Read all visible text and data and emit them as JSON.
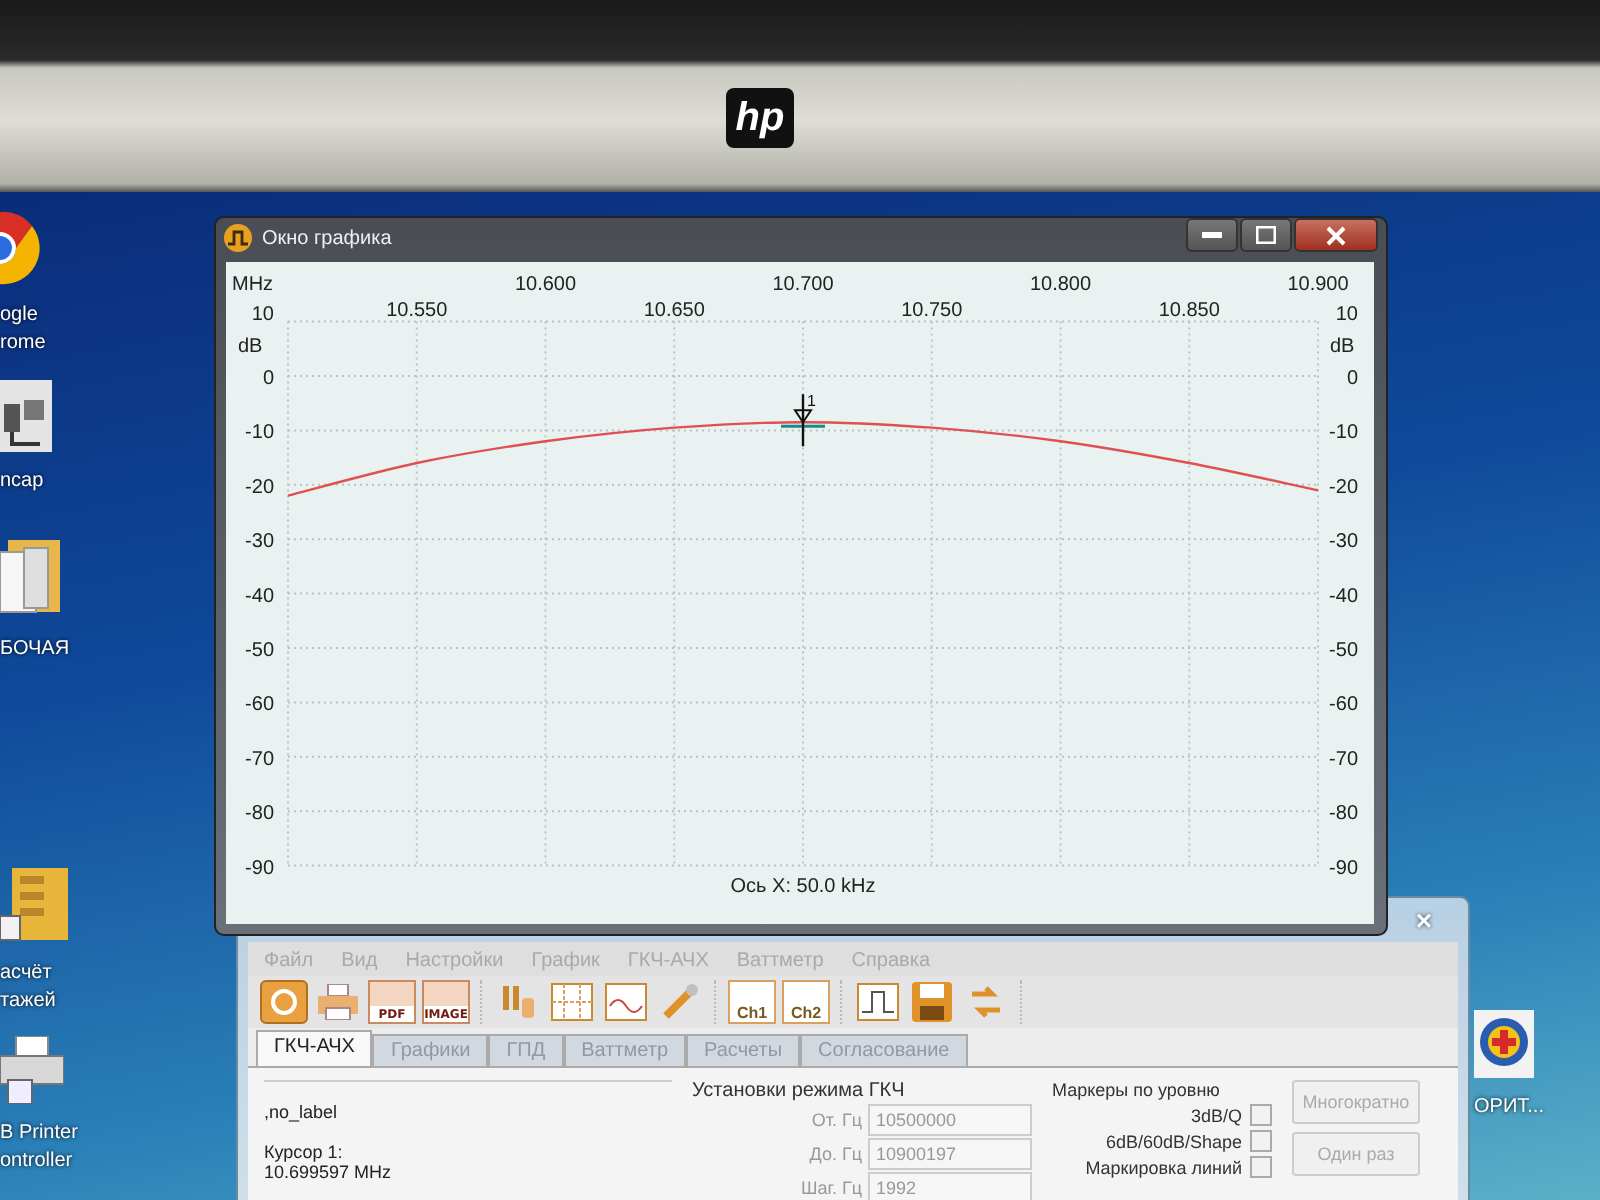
{
  "monitor": {
    "logo": "hp"
  },
  "desktop_icons": [
    {
      "kind": "chrome",
      "label": "ogle rome"
    },
    {
      "kind": "app",
      "label": "ncap"
    },
    {
      "kind": "folder",
      "label": "БОЧАЯ"
    },
    {
      "kind": "building",
      "label": "асчёт тажей"
    },
    {
      "kind": "printer",
      "label": "B Printer ontroller"
    },
    {
      "kind": "emblem",
      "label": "ОРИТ..."
    }
  ],
  "graph_window": {
    "title": "Окно графика",
    "scale_note": "Ось X: 50.0 kHz",
    "chart_data": {
      "type": "line",
      "xlabel": "MHz",
      "ylabel": "dB",
      "x": [
        10.5,
        10.55,
        10.6,
        10.65,
        10.7,
        10.75,
        10.8,
        10.85,
        10.9
      ],
      "series": [
        {
          "color": "#e05050",
          "values": [
            -22,
            -16,
            -12,
            -9.5,
            -8.5,
            -9.5,
            -12,
            -16,
            -21
          ]
        }
      ],
      "grid": true,
      "xlim": [
        10.5,
        10.9
      ],
      "ylim": [
        -90,
        10
      ],
      "xticks": [
        {
          "value": 10.55,
          "label": "10.550"
        },
        {
          "value": 10.65,
          "label": "10.650"
        },
        {
          "value": 10.75,
          "label": "10.750"
        },
        {
          "value": 10.85,
          "label": "10.850"
        }
      ],
      "yticks": [
        10,
        0,
        -10,
        -20,
        -30,
        -40,
        -50,
        -60,
        -70,
        -80,
        -90
      ],
      "annotations": [
        {
          "x": 10.7,
          "y": -8.5,
          "text": "1"
        }
      ]
    },
    "upper_x_labels": [
      "10.600",
      "10.700",
      "10.800",
      "10.900"
    ],
    "left_axis": {
      "labels": [
        "10",
        "0",
        "-10",
        "-20",
        "-30",
        "-40",
        "-50",
        "-60",
        "-70",
        "-80",
        "-90"
      ]
    },
    "right_axis": {
      "unit": "dB",
      "labels": [
        "10",
        "0",
        "-10",
        "-20",
        "-30",
        "-40",
        "-50",
        "-60",
        "-70",
        "-80",
        "-90"
      ]
    }
  },
  "main_window": {
    "close": "×",
    "menu": [
      "Файл",
      "Вид",
      "Настройки",
      "График",
      "ГКЧ-АЧХ",
      "Ваттметр",
      "Справка"
    ],
    "toolbar": [
      [
        {
          "kind": "power"
        },
        {
          "kind": "printer"
        },
        {
          "kind": "doc",
          "label": "PDF"
        },
        {
          "kind": "doc",
          "label": "IMAGE"
        }
      ],
      [
        {
          "kind": "tools"
        },
        {
          "kind": "grid"
        },
        {
          "kind": "wave"
        },
        {
          "kind": "wrench"
        }
      ],
      [
        {
          "kind": "channel",
          "label": "Ch1"
        },
        {
          "kind": "channel",
          "label": "Ch2"
        }
      ],
      [
        {
          "kind": "step"
        },
        {
          "kind": "save"
        },
        {
          "kind": "swap"
        }
      ]
    ],
    "tabs": [
      {
        "label": "ГКЧ-АЧХ",
        "selected": true
      },
      {
        "label": "Графики",
        "selected": false
      },
      {
        "label": "ГПД",
        "selected": false
      },
      {
        "label": "Ваттметр",
        "selected": false
      },
      {
        "label": "Расчеты",
        "selected": false
      },
      {
        "label": "Согласование",
        "selected": false
      }
    ],
    "cursor_panel": {
      "name": ",no_label",
      "cursor_label": "Курсор 1:",
      "cursor_value": "10.699597 MHz"
    },
    "generator": {
      "title": "Установки режима ГКЧ",
      "fields": [
        {
          "label": "От. Гц",
          "value": "10500000"
        },
        {
          "label": "До. Гц",
          "value": "10900197"
        },
        {
          "label": "Шаг. Гц",
          "value": "1992"
        }
      ]
    },
    "markers": {
      "title": "Маркеры по уровню",
      "options": [
        {
          "label": "3dB/Q",
          "checked": false
        },
        {
          "label": "6dB/60dB/Shape",
          "checked": false
        },
        {
          "label": "Маркировка линий",
          "checked": false
        }
      ]
    },
    "buttons": [
      "Многократно",
      "Один раз"
    ]
  }
}
